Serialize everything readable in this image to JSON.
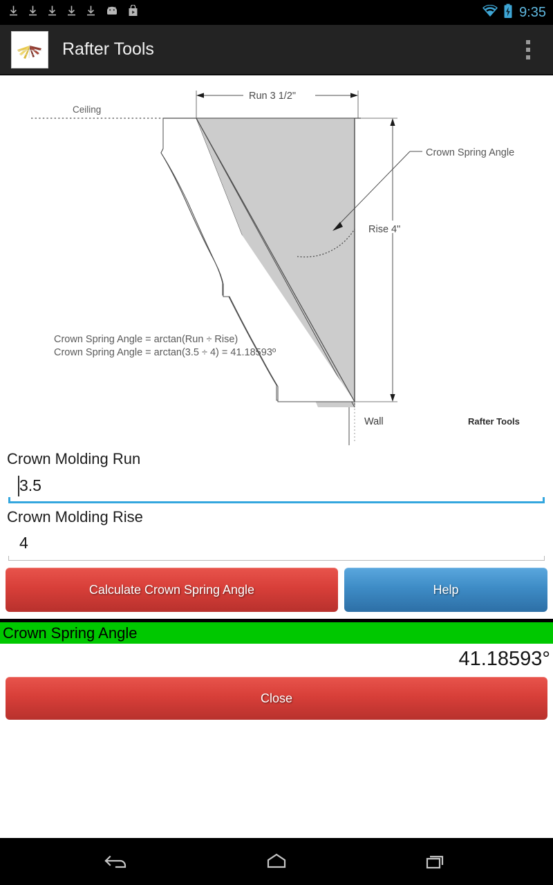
{
  "status_bar": {
    "time": "9:35",
    "left_icons": [
      "download-icon",
      "download-icon",
      "download-icon",
      "download-icon",
      "download-icon",
      "android-icon",
      "play-store-icon"
    ],
    "right_icons": [
      "wifi-icon",
      "battery-charging-icon"
    ],
    "clock_color": "#5FB8E0"
  },
  "action_bar": {
    "title": "Rafter Tools",
    "app_icon": "rafter-tools-logo",
    "overflow": "overflow-menu-icon",
    "background": "#232323"
  },
  "diagram": {
    "run_label": "Run 3 1/2\"",
    "rise_label": "Rise 4\"",
    "ceiling_label": "Ceiling",
    "wall_label": "Wall",
    "angle_callout": "Crown Spring Angle",
    "formula_line1": "Crown Spring Angle = arctan(Run ÷ Rise)",
    "formula_line2": "Crown Spring Angle = arctan(3.5 ÷ 4) = 41.18593º",
    "watermark": "Rafter Tools",
    "fill_color": "#cccccc",
    "line_color": "#4d4d4d"
  },
  "form": {
    "run": {
      "label": "Crown Molding Run",
      "value": "3.5",
      "placeholder": "",
      "focused": true
    },
    "rise": {
      "label": "Crown Molding Rise",
      "value": "4",
      "placeholder": "",
      "focused": false
    }
  },
  "buttons": {
    "calculate": "Calculate Crown Spring Angle",
    "help": "Help",
    "close": "Close",
    "red_color": "#D83F39",
    "blue_color": "#3E8CC6"
  },
  "result": {
    "header_label": "Crown Spring Angle",
    "value": "41.18593°",
    "header_background": "#00C800",
    "header_text_color": "#000000"
  },
  "nav_bar": {
    "back": "back-icon",
    "home": "home-icon",
    "recents": "recents-icon"
  }
}
